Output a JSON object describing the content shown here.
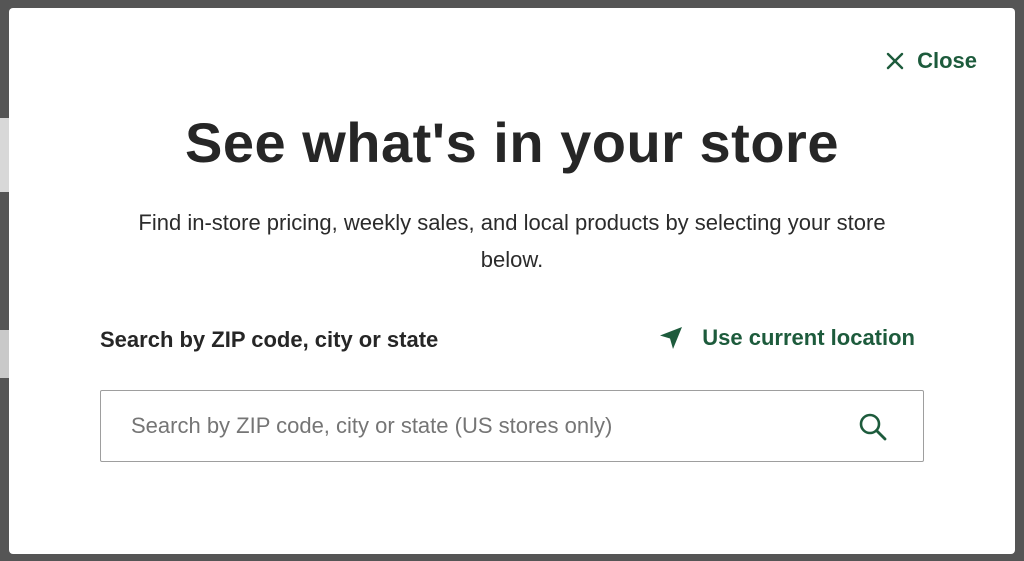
{
  "modal": {
    "close_label": "Close",
    "title": "See what's in your store",
    "subtitle": "Find in-store pricing, weekly sales, and local products by selecting your store below.",
    "search_label": "Search by ZIP code, city or state",
    "use_location_label": "Use current location",
    "search_input": {
      "value": "",
      "placeholder": "Search by ZIP code, city or state (US stores only)"
    }
  },
  "icons": {
    "close": "close-icon",
    "location": "location-arrow-icon",
    "search": "search-icon"
  },
  "colors": {
    "accent": "#1d5b3c",
    "title": "#262626",
    "overlay": "#555555",
    "input_border": "#9e9e9e",
    "placeholder": "#757575"
  }
}
